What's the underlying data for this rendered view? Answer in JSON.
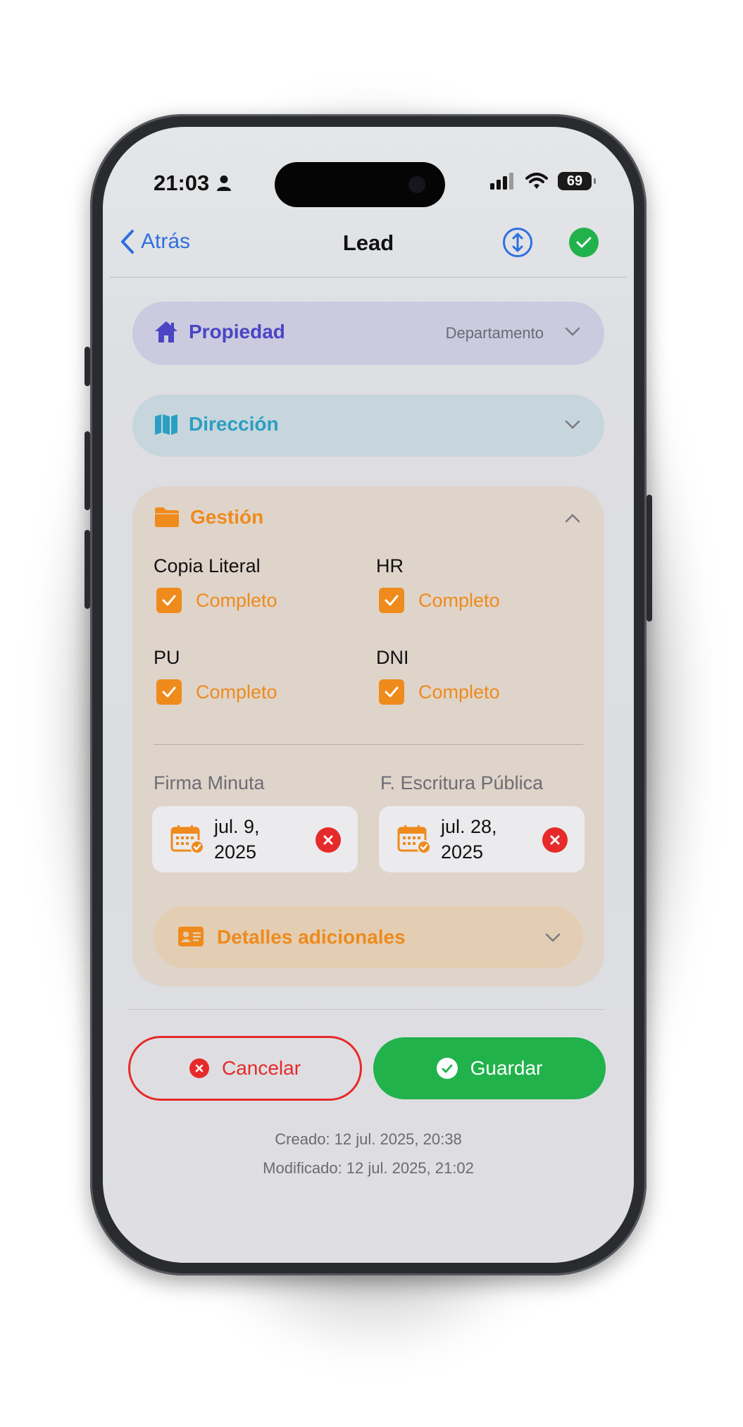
{
  "status_bar": {
    "time": "21:03",
    "battery": "69"
  },
  "nav": {
    "back_label": "Atrás",
    "title": "Lead"
  },
  "sections": {
    "propiedad": {
      "title": "Propiedad",
      "value": "Departamento"
    },
    "direccion": {
      "title": "Dirección"
    },
    "gestion": {
      "title": "Gestión",
      "documents": [
        {
          "label": "Copia Literal",
          "status": "Completo"
        },
        {
          "label": "HR",
          "status": "Completo"
        },
        {
          "label": "PU",
          "status": "Completo"
        },
        {
          "label": "DNI",
          "status": "Completo"
        }
      ],
      "dates": [
        {
          "label": "Firma Minuta",
          "value": "jul. 9, 2025"
        },
        {
          "label": "F. Escritura Pública",
          "value": "jul. 28, 2025"
        }
      ],
      "details": {
        "title": "Detalles adicionales"
      }
    }
  },
  "actions": {
    "cancel_label": "Cancelar",
    "save_label": "Guardar"
  },
  "meta": {
    "created": "Creado: 12 jul. 2025, 20:38",
    "modified": "Modificado: 12 jul. 2025, 21:02"
  },
  "colors": {
    "accent_blue": "#2f6fe0",
    "propiedad": "#4a45c4",
    "direccion": "#2b9fc2",
    "gestion": "#ef8a1c",
    "danger": "#e62a2a",
    "success": "#22b24c"
  }
}
